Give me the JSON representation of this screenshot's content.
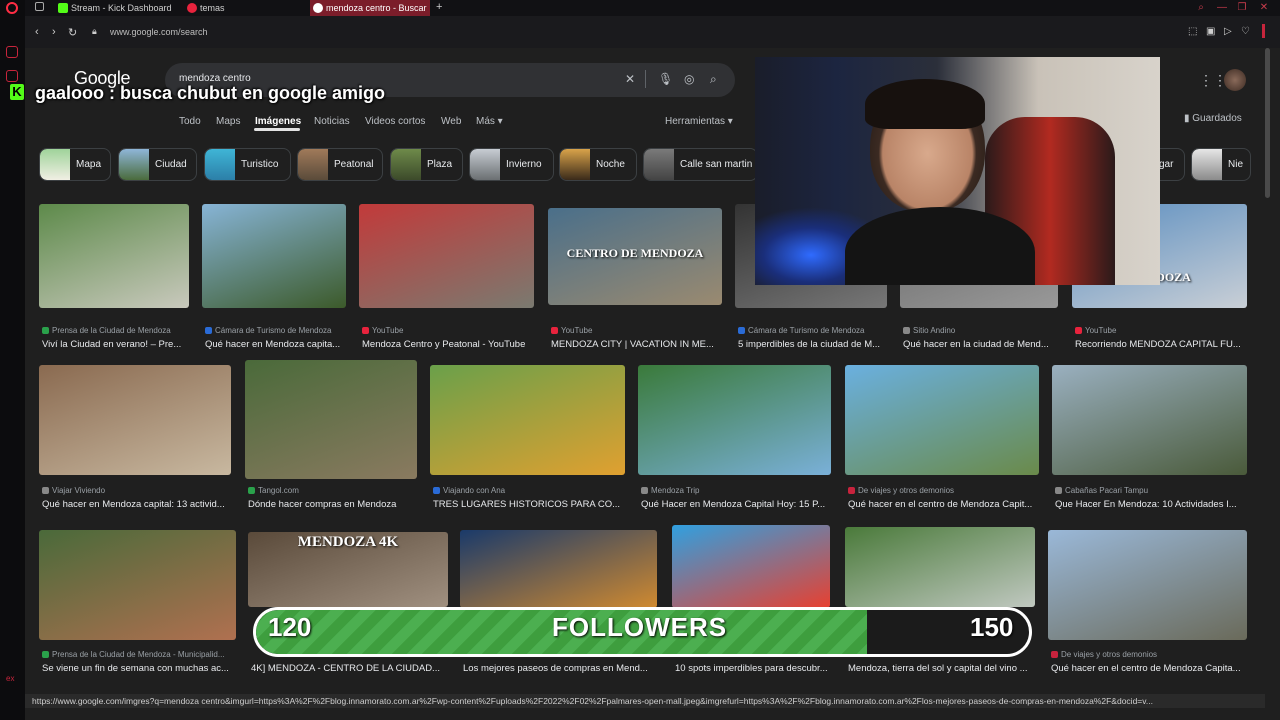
{
  "browser": {
    "tabs": [
      {
        "label": "Stream - Kick Dashboard",
        "color": "#53fc18"
      },
      {
        "label": "temas",
        "color": "#e8233d"
      },
      {
        "label": "mendoza centro - Buscar",
        "color": "#ea4335"
      }
    ],
    "url": "www.google.com/search"
  },
  "google": {
    "logo": "Google",
    "query": "mendoza centro",
    "nav": [
      "Todo",
      "Maps",
      "Imágenes",
      "Noticias",
      "Videos cortos",
      "Web",
      "Más ▾"
    ],
    "tools": "Herramientas ▾",
    "saved": "Guardados",
    "chips": [
      "Mapa",
      "Ciudad",
      "Turistico",
      "Peatonal",
      "Plaza",
      "Invierno",
      "Noche",
      "Calle san martin",
      "gar",
      "Nie"
    ]
  },
  "overlay": {
    "chat_user": "gaalooo",
    "chat_msg": ": busca chubut en google amigo",
    "followers_label": "FOLLOWERS",
    "followers_current": "120",
    "followers_goal": "150",
    "followers_progress": 0.79
  },
  "results": [
    {
      "source": "Prensa de la Ciudad de Mendoza",
      "title": "Viví la Ciudad en verano! – Pre..."
    },
    {
      "source": "Cámara de Turismo de Mendoza",
      "title": "Qué hacer en Mendoza capita..."
    },
    {
      "source": "YouTube",
      "title": "Mendoza Centro y Peatonal - YouTube"
    },
    {
      "source": "YouTube",
      "title": "MENDOZA CITY | VACATION IN ME...",
      "caption": "CENTRO DE MENDOZA"
    },
    {
      "source": "Cámara de Turismo de Mendoza",
      "title": "5 imperdibles de la ciudad de M..."
    },
    {
      "source": "Sitio Andino",
      "title": "Qué hacer en la ciudad de Mend..."
    },
    {
      "source": "YouTube",
      "title": "Recorriendo MENDOZA CAPITAL FU...",
      "caption": "MENDOZA"
    },
    {
      "source": "Viajar Viviendo",
      "title": "Qué hacer en Mendoza capital: 13 activid..."
    },
    {
      "source": "Tangol.com",
      "title": "Dónde hacer compras en Mendoza"
    },
    {
      "source": "Viajando con Ana",
      "title": "TRES LUGARES HISTORICOS PARA CO..."
    },
    {
      "source": "Mendoza Trip",
      "title": "Qué Hacer en Mendoza Capital Hoy: 15 P..."
    },
    {
      "source": "De viajes y otros demonios",
      "title": "Qué hacer en el centro de Mendoza Capit..."
    },
    {
      "source": "Cabañas Pacari Tampu",
      "title": "Que Hacer En Mendoza: 10 Actividades I..."
    },
    {
      "source": "Prensa de la Ciudad de Mendoza - Municipalid...",
      "title": "Se viene un fin de semana con muchas ac..."
    },
    {
      "source": "",
      "title": "4K] MENDOZA - CENTRO DE LA CIUDAD...",
      "caption": "MENDOZA 4K"
    },
    {
      "source": "",
      "title": "Los mejores paseos de compras en Mend..."
    },
    {
      "source": "",
      "title": "10 spots imperdibles para descubr..."
    },
    {
      "source": "",
      "title": "Mendoza, tierra del sol y capital del vino ..."
    },
    {
      "source": "De viajes y otros demonios",
      "title": "Qué hacer en el centro de Mendoza Capita..."
    }
  ],
  "status_url": "https://www.google.com/imgres?q=mendoza centro&imgurl=https%3A%2F%2Fblog.innamorato.com.ar%2Fwp-content%2Fuploads%2F2022%2F02%2Fpalmares-open-mall.jpeg&imgrefurl=https%3A%2F%2Fblog.innamorato.com.ar%2Flos-mejores-paseos-de-compras-en-mendoza%2F&docid=v..."
}
